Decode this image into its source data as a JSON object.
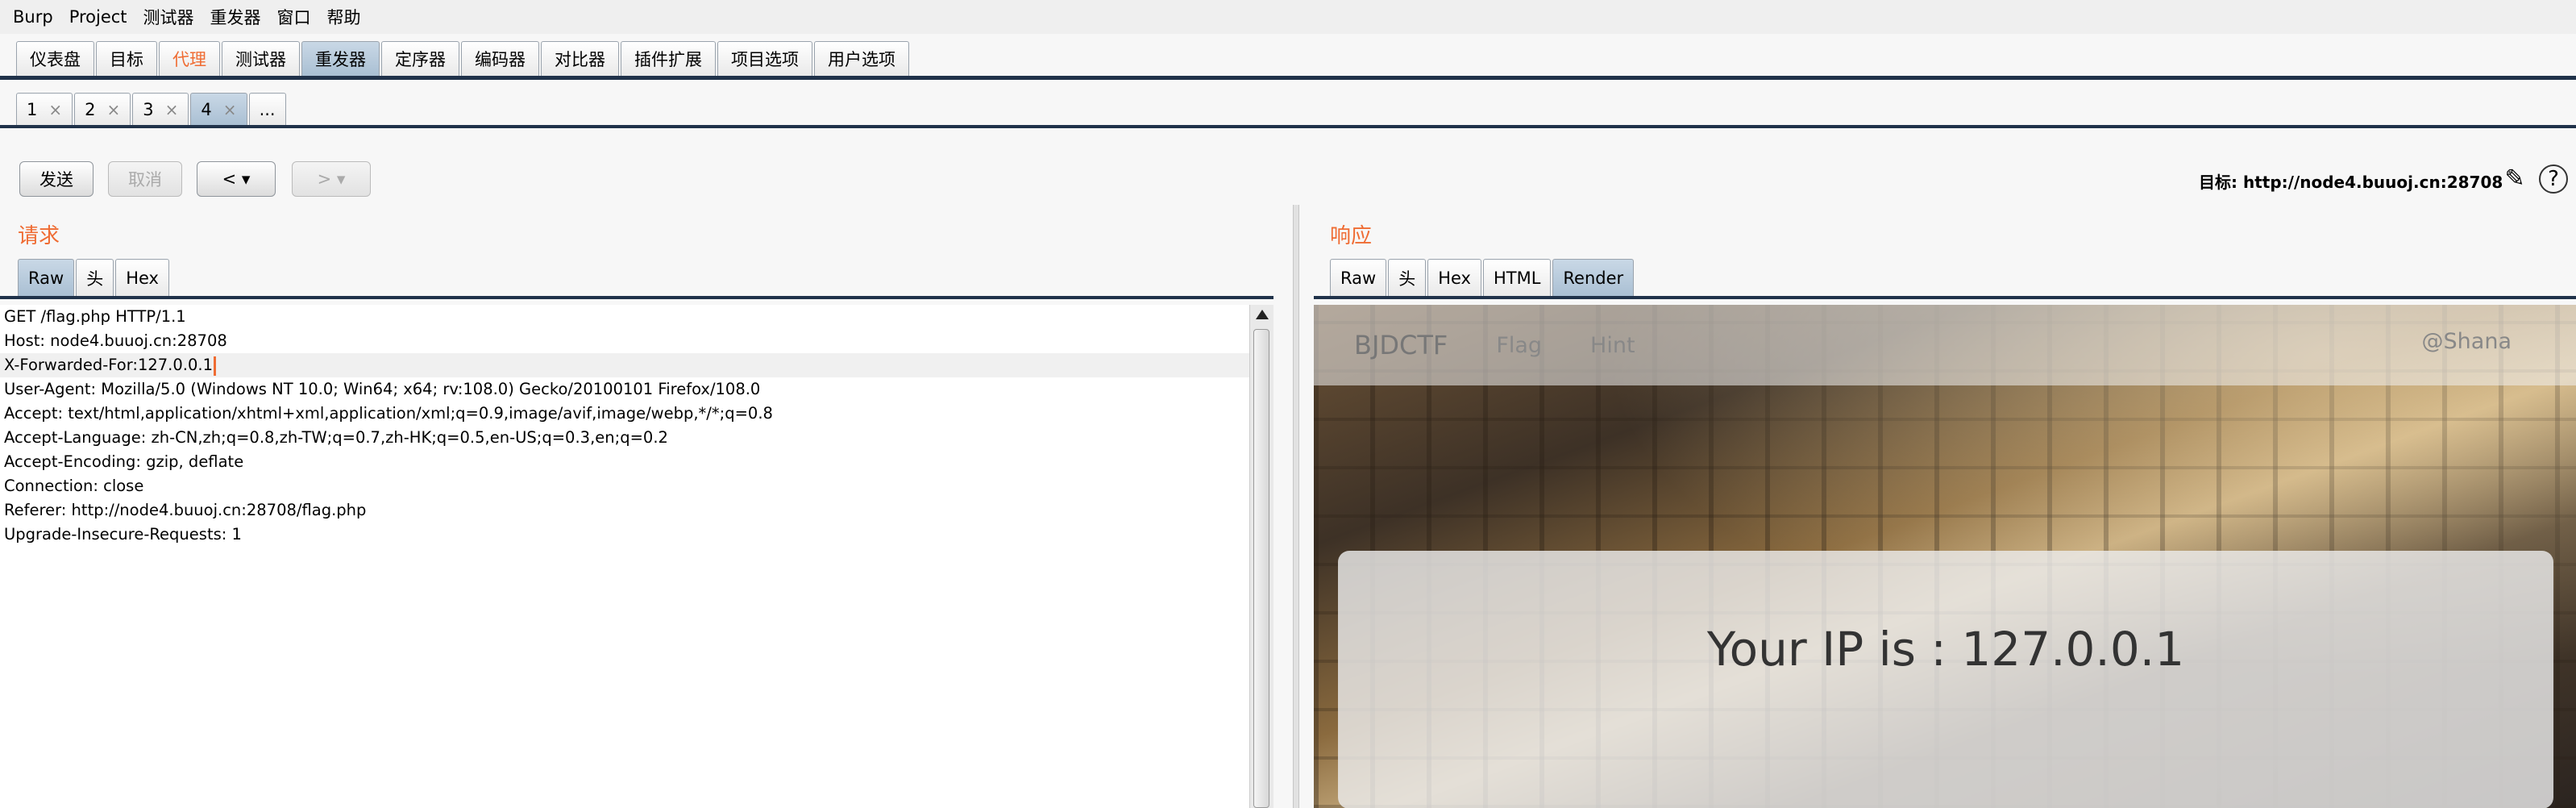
{
  "menu": [
    "Burp",
    "Project",
    "测试器",
    "重发器",
    "窗口",
    "帮助"
  ],
  "main_tabs": [
    {
      "label": "仪表盘"
    },
    {
      "label": "目标"
    },
    {
      "label": "代理"
    },
    {
      "label": "测试器"
    },
    {
      "label": "重发器"
    },
    {
      "label": "定序器"
    },
    {
      "label": "编码器"
    },
    {
      "label": "对比器"
    },
    {
      "label": "插件扩展"
    },
    {
      "label": "项目选项"
    },
    {
      "label": "用户选项"
    }
  ],
  "repeater_tabs": [
    {
      "label": "1",
      "close": "×"
    },
    {
      "label": "2",
      "close": "×"
    },
    {
      "label": "3",
      "close": "×"
    },
    {
      "label": "4",
      "close": "×"
    }
  ],
  "more_tab": "...",
  "toolbar": {
    "send": "发送",
    "cancel": "取消",
    "back": "< ▾",
    "forward": "> ▾",
    "target": "目标: http://node4.buuoj.cn:28708"
  },
  "request": {
    "title": "请求",
    "tabs": [
      "Raw",
      "头",
      "Hex"
    ],
    "lines": [
      "GET /flag.php HTTP/1.1",
      "Host: node4.buuoj.cn:28708",
      "X-Forwarded-For:127.0.0.1",
      "User-Agent: Mozilla/5.0 (Windows NT 10.0; Win64; x64; rv:108.0) Gecko/20100101 Firefox/108.0",
      "Accept: text/html,application/xhtml+xml,application/xml;q=0.9,image/avif,image/webp,*/*;q=0.8",
      "Accept-Language: zh-CN,zh;q=0.8,zh-TW;q=0.7,zh-HK;q=0.5,en-US;q=0.3,en;q=0.2",
      "Accept-Encoding: gzip, deflate",
      "Connection: close",
      "Referer: http://node4.buuoj.cn:28708/flag.php",
      "Upgrade-Insecure-Requests: 1"
    ]
  },
  "response": {
    "title": "响应",
    "tabs": [
      "Raw",
      "头",
      "Hex",
      "HTML",
      "Render"
    ],
    "page": {
      "brand": "BJDCTF",
      "nav": [
        "Flag",
        "Hint"
      ],
      "user": "@Shana",
      "ip_text": "Your IP is : 127.0.0.1"
    }
  },
  "colors": {
    "accent": "#ef6c33",
    "tab_selected": "#b7cadc",
    "rule": "#20324a"
  }
}
